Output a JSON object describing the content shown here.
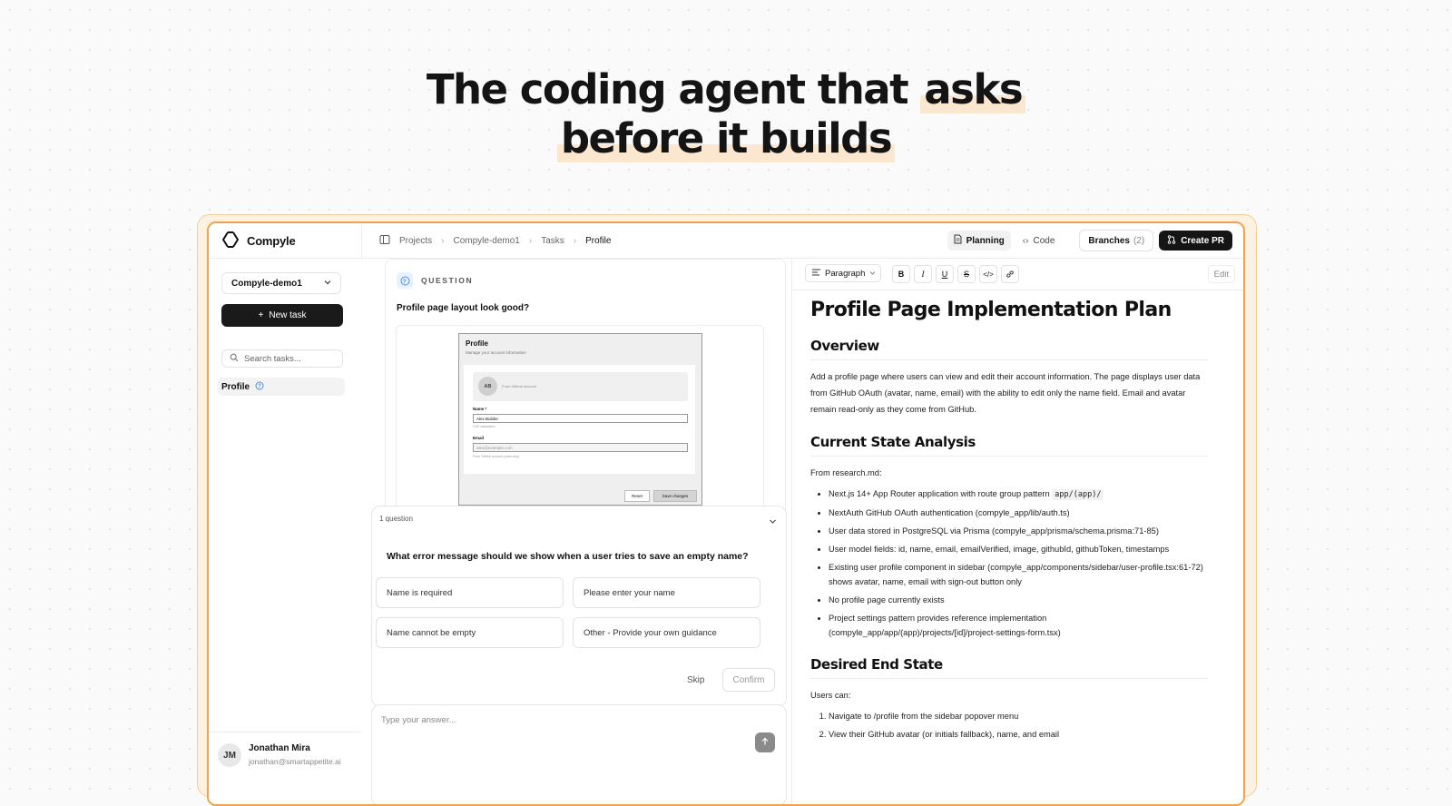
{
  "hero": {
    "line1_text": "The coding agent that",
    "line1_highlight": "asks",
    "line2_highlight": "before it builds"
  },
  "sidebar": {
    "brand": "Compyle",
    "project": "Compyle-demo1",
    "new_task_label": "New task",
    "search_placeholder": "Search tasks...",
    "tasks": [
      {
        "label": "Profile"
      }
    ],
    "user": {
      "initials": "JM",
      "name": "Jonathan Mira",
      "email": "jonathan@smartappetite.ai"
    }
  },
  "topbar": {
    "breadcrumbs": [
      "Projects",
      "Compyle-demo1",
      "Tasks",
      "Profile"
    ],
    "planning_label": "Planning",
    "code_label": "Code",
    "branches_label": "Branches",
    "branches_count": "(2)",
    "create_pr_label": "Create PR"
  },
  "chat": {
    "question_heading": "QUESTION",
    "question_text": "Profile page layout look good?",
    "preview": {
      "title": "Profile",
      "subtitle": "Manage your account information",
      "avatar_initials": "AB",
      "github_label": "From GitHub account",
      "name_label": "Name *",
      "name_value": "Alex Builder",
      "name_hint": "2-60 characters",
      "email_label": "Email",
      "email_value": "alex@example.com",
      "email_hint": "From GitHub account (read-only)",
      "reset_label": "Reset",
      "save_label": "Save changes"
    },
    "panel": {
      "count_label": "1 question",
      "question": "What error message should we show when a user tries to save an empty name?",
      "options": [
        "Name is required",
        "Please enter your name",
        "Name cannot be empty",
        "Other - Provide your own guidance"
      ],
      "skip_label": "Skip",
      "confirm_label": "Confirm"
    },
    "answer_placeholder": "Type your answer..."
  },
  "doc": {
    "paragraph_style": "Paragraph",
    "edit_label": "Edit",
    "title": "Profile Page Implementation Plan",
    "overview_heading": "Overview",
    "overview_text": "Add a profile page where users can view and edit their account information. The page displays user data from GitHub OAuth (avatar, name, email) with the ability to edit only the name field. Email and avatar remain read-only as they come from GitHub.",
    "state_heading": "Current State Analysis",
    "state_intro": "From research.md:",
    "state_item1_text": "Next.js 14+ App Router application with route group pattern",
    "state_item1_code": "app/(app)/",
    "state_items": [
      "NextAuth GitHub OAuth authentication (compyle_app/lib/auth.ts)",
      "User data stored in PostgreSQL via Prisma (compyle_app/prisma/schema.prisma:71-85)",
      "User model fields: id, name, email, emailVerified, image, githubId, githubToken, timestamps",
      "Existing user profile component in sidebar (compyle_app/components/sidebar/user-profile.tsx:61-72) shows avatar, name, email with sign-out button only",
      "No profile page currently exists",
      "Project settings pattern provides reference implementation (compyle_app/app/(app)/projects/[id]/project-settings-form.tsx)"
    ],
    "end_heading": "Desired End State",
    "end_intro": "Users can:",
    "end_items": [
      "Navigate to /profile from the sidebar popover menu",
      "View their GitHub avatar (or initials fallback), name, and email"
    ]
  },
  "colors": {
    "accent": "#f0a24c",
    "dark": "#151515",
    "highlight": "#fbe6cf"
  }
}
